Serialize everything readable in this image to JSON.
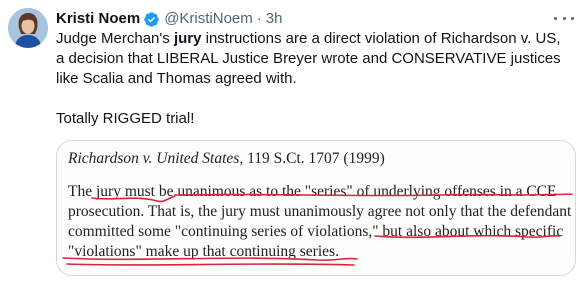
{
  "author": {
    "name": "Kristi Noem",
    "handle": "@KristiNoem",
    "separator": "·",
    "time": "3h"
  },
  "post": {
    "line1_pre": "Judge Merchan's ",
    "line1_bold": "jury",
    "line1_post": " instructions are a direct violation of Richardson v. US,",
    "line2": "a decision that LIBERAL Justice Breyer wrote and CONSERVATIVE justices",
    "line3": "like Scalia and Thomas agreed with.",
    "line4": "Totally RIGGED trial!"
  },
  "media": {
    "case_name": "Richardson v. United States",
    "case_cite": ", 119 S.Ct. 1707 (1999)",
    "quote_lines": [
      "The jury must be unanimous as to the \"series\" of underlying offenses in a CCE",
      "prosecution. That is, the jury must unanimously agree not only that the defendant",
      "committed some \"continuing series of violations,\" but also about which specific",
      "\"violations\" make up that continuing series."
    ],
    "annotation_color": "#d7263d"
  }
}
